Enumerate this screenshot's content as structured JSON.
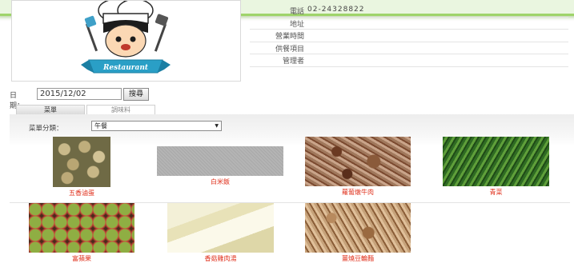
{
  "restaurant": {
    "logo_text": "Restaurant",
    "info": [
      {
        "label": "電話",
        "value": "02-24328822"
      },
      {
        "label": "地址",
        "value": ""
      },
      {
        "label": "營業時間",
        "value": ""
      },
      {
        "label": "供餐項目",
        "value": ""
      },
      {
        "label": "管理者",
        "value": ""
      }
    ]
  },
  "date_search": {
    "label": "日期：",
    "value": "2015/12/02",
    "button_label": "搜尋"
  },
  "tabs": [
    {
      "label": "菜單",
      "active": true
    },
    {
      "label": "調味料",
      "active": false
    }
  ],
  "menu": {
    "category_label": "菜單分類：",
    "category_selected": "午餐",
    "dishes": [
      {
        "name": "五香滷蛋"
      },
      {
        "name": "白米飯"
      },
      {
        "name": "蘿蔔燉牛肉"
      },
      {
        "name": "青菜"
      },
      {
        "name": "富蘋果"
      },
      {
        "name": "香菇雞肉湯"
      },
      {
        "name": "薑燒豆輪麵"
      }
    ]
  },
  "colors": {
    "callout_border": "#9fd46a",
    "dish_name": "#e0321e"
  }
}
